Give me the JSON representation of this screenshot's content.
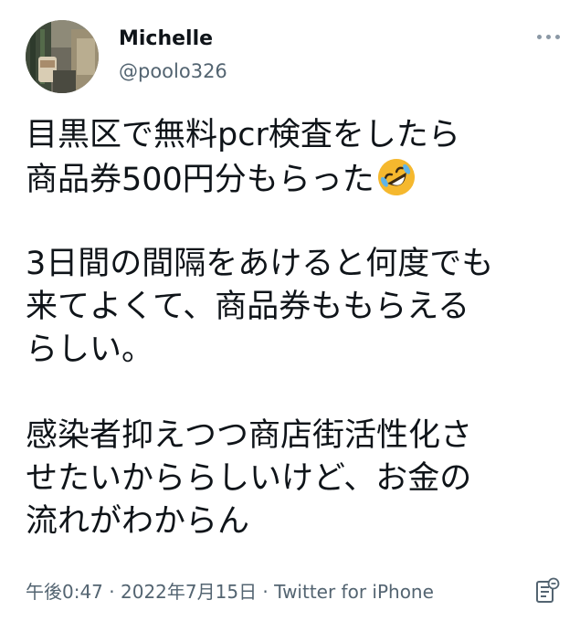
{
  "user": {
    "display_name": "Michelle",
    "handle": "@poolo326"
  },
  "tweet": {
    "paragraphs": [
      {
        "lines": [
          "目黒区で無料pcr検査をしたら",
          "商品券500円分もらった"
        ],
        "trailing_emoji": "rolling-on-floor-laughing-emoji"
      },
      {
        "lines": [
          "3日間の間隔をあけると何度でも",
          "来てよくて、商品券ももらえる",
          "らしい。"
        ]
      },
      {
        "lines": [
          "感染者抑えつつ商店街活性化さ",
          "せたいかららしいけど、お金の",
          "流れがわからん"
        ]
      }
    ]
  },
  "meta": {
    "time": "午後0:47",
    "separator1": " · ",
    "date": "2022年7月15日",
    "separator2": " · ",
    "source": "Twitter for iPhone"
  },
  "icons": {
    "more": "more-horizontal-icon",
    "notes": "notes-icon"
  },
  "colors": {
    "text": "#0f1419",
    "secondary": "#536471",
    "emoji_face": "#f5b82e"
  }
}
